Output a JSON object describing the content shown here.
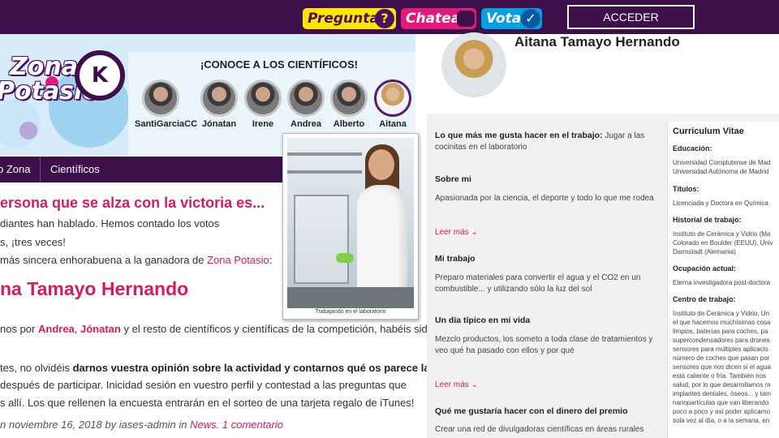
{
  "topbar": {
    "pregunta": "Pregunta",
    "chatea": "Chatea",
    "vota": "Vota",
    "acceder": "ACCEDER",
    "icons": [
      "question-icon",
      "chat-bubble-icon",
      "checkmark-icon"
    ],
    "colors": {
      "bar": "#3d0f4b",
      "pregunta": "#ffe600",
      "chatea": "#e6187c",
      "vota": "#00a0e3"
    }
  },
  "logo": {
    "line1": "Zona",
    "line2": "Potasio",
    "badge": "K"
  },
  "scientists": {
    "heading": "¡CONOCE A LOS CIENTÍFICOS!",
    "items": [
      {
        "name": "SantiGarciaCC"
      },
      {
        "name": "Jónatan"
      },
      {
        "name": "Irene"
      },
      {
        "name": "Andrea"
      },
      {
        "name": "Alberto"
      },
      {
        "name": "Aitana"
      }
    ]
  },
  "nav": {
    "item1": "o Zona",
    "item2": "Científicos"
  },
  "article": {
    "headline": "ersona que se alza con la victoria es...",
    "line1": "diantes han hablado. Hemos contado los votos",
    "line2": "s, ¡tres veces!",
    "line3_pre": "más sincera enhorabuena a la ganadora de ",
    "line3_link": "Zona Potasio",
    "line3_post": ":",
    "winner": "na Tamayo Hernando",
    "line4_pre": "nos por ",
    "line4_a": "Andrea",
    "line4_sep": ", ",
    "line4_b": "Jónatan",
    "line4_post": " y el resto de científicos y científicas de la competición, habéis sido",
    "line5_pre": "tes, no olvidéis ",
    "line5_bold": "darnos vuestra opinión sobre la actividad y contarnos qué os parece la",
    "line6": "después de participar. Inicidad sesión en vuestro perfil y contestad a las preguntas que",
    "line7": "s allí. Los que rellenen la encuesta entrarán en el sorteo de una tarjeta regalo de iTunes!",
    "meta_pre": "n noviembre 16, 2018 by iases-admin in ",
    "meta_cat": "News",
    "meta_sep": ". ",
    "meta_comments": "1 comentario",
    "photo_caption": "Trabajando en el laboratorio"
  },
  "profile": {
    "name": "Aitana Tamayo Hernando",
    "fav_label": "Lo que más me gusta hacer en el trabajo:",
    "fav_text": " Jugar a las cocinitas en el laboratorio",
    "sobre_title": "Sobre mi",
    "sobre_text": "Apasionada por la ciencia, el deporte y todo lo que me rodea",
    "leer_mas": "Leer más ⌄",
    "trabajo_title": "Mi trabajo",
    "trabajo_text": "Preparo materiales para convertir el agua y el CO2 en un combustible... y utilizando sólo la luz del sol",
    "dia_title": "Un día típico en mi vida",
    "dia_text": "Mezclo productos, los someto a toda clase de tratamientos y veo qué ha pasado con ellos y por qué",
    "premio_title": "Qué me gustaría hacer con el dinero del premio",
    "premio_text": "Crear una red de divulgadoras científicas en áreas rurales"
  },
  "cv": {
    "title": "Curriculum Vitae",
    "edu_h": "Educación:",
    "edu_1": "Universidad Complutense de Mad",
    "edu_2": "Universidad Autónoma de Madrid",
    "tit_h": "Títulos:",
    "tit_1": "Licenciada y Doctora en Química",
    "hist_h": "Historial de trabajo:",
    "hist_1": "Instituto de Cerámica y Vidrio (Ma",
    "hist_2": "Colorado en Boulder (EEUU), Univ",
    "hist_3": "Darmstadt (Alemania)",
    "ocup_h": "Ocupación actual:",
    "ocup_1": "Eterna investigadora post-doctora",
    "centro_h": "Centro de trabajo:",
    "centro_lines": [
      "Instituto de Cerámica y Vidrio. Un",
      "el que hacemos muchísimas cosa",
      "limpios, baterías para coches, pa",
      "supercondensadores para drones",
      "sensores para múltiples aplicacio",
      "número de coches que pasan por",
      "sensores que nos dicen si el agua",
      "está caliente o fría. También nos",
      "salud, por lo que desarrollamos m",
      "implantes dentales, óseos... y tam",
      "nanopartículas que van liberando",
      "poco a poco y así poder aplicarno",
      "sola vez al día, o a la semana, en"
    ]
  }
}
